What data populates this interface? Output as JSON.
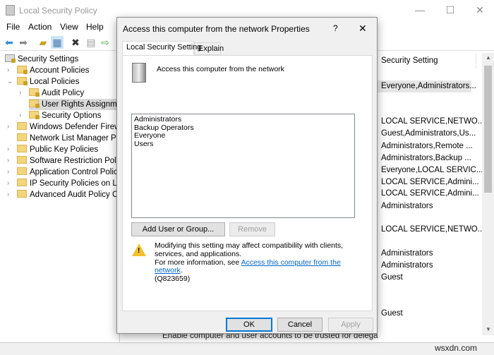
{
  "window": {
    "title": "Local Security Policy",
    "minimize": "—",
    "maximize": "☐",
    "close": "✕"
  },
  "menu": [
    "File",
    "Action",
    "View",
    "Help"
  ],
  "toolbar": {
    "icons": [
      "back-arrow-icon",
      "forward-arrow-icon",
      "up-folder-icon",
      "show-hide-tree-icon",
      "delete-icon",
      "properties-icon",
      "export-list-icon"
    ]
  },
  "tree": {
    "root": "Security Settings",
    "items": [
      {
        "label": "Account Policies",
        "indent": 1,
        "expand": ">"
      },
      {
        "label": "Local Policies",
        "indent": 1,
        "expand": "v"
      },
      {
        "label": "Audit Policy",
        "indent": 2,
        "expand": ">"
      },
      {
        "label": "User Rights Assignment",
        "indent": 2,
        "expand": ""
      },
      {
        "label": "Security Options",
        "indent": 2,
        "expand": ">"
      },
      {
        "label": "Windows Defender Firewall with Advanced Security",
        "indent": 1,
        "expand": ">"
      },
      {
        "label": "Network List Manager Policies",
        "indent": 1,
        "expand": ""
      },
      {
        "label": "Public Key Policies",
        "indent": 1,
        "expand": ">"
      },
      {
        "label": "Software Restriction Policies",
        "indent": 1,
        "expand": ">"
      },
      {
        "label": "Application Control Policies",
        "indent": 1,
        "expand": ">"
      },
      {
        "label": "IP Security Policies on Local Computer",
        "indent": 1,
        "expand": ">"
      },
      {
        "label": "Advanced Audit Policy Configuration",
        "indent": 1,
        "expand": ">"
      }
    ]
  },
  "list": {
    "header": "Security Setting",
    "values": [
      "Everyone,Administrators...",
      "LOCAL SERVICE,NETWO...",
      "Guest,Administrators,Us...",
      "Administrators,Remote ...",
      "Administrators,Backup ...",
      "Everyone,LOCAL SERVIC...",
      "LOCAL SERVICE,Admini...",
      "LOCAL SERVICE,Admini...",
      "Administrators",
      "LOCAL SERVICE,NETWO...",
      "Administrators",
      "Administrators",
      "Guest",
      "Guest"
    ],
    "behind_row": "Enable computer and user accounts to be trusted for delega"
  },
  "dialog": {
    "title": "Access this computer from the network Properties",
    "help": "?",
    "close": "✕",
    "tabs": [
      "Local Security Setting",
      "Explain"
    ],
    "policy_name": "Access this computer from the network",
    "members": [
      "Administrators",
      "Backup Operators",
      "Everyone",
      "Users"
    ],
    "add_button": "Add User or Group...",
    "remove_button": "Remove",
    "warning": {
      "text": "Modifying this setting may affect compatibility with clients, services, and applications.",
      "more_prefix": "For more information, see ",
      "link": "Access this computer from the network",
      "suffix": ".",
      "kb": "(Q823659)"
    },
    "ok": "OK",
    "cancel": "Cancel",
    "apply": "Apply"
  },
  "watermark": "wsxdn.com"
}
